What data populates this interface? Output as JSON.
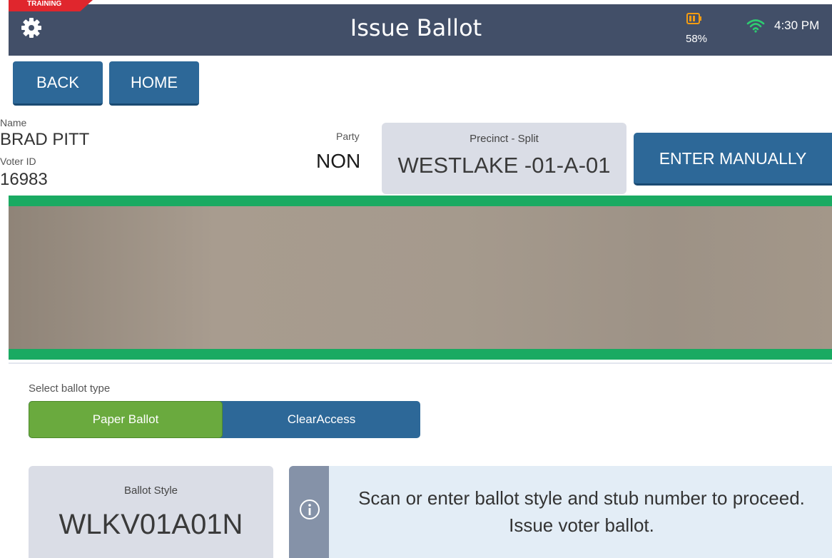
{
  "header": {
    "training_label": "TRAINING",
    "title": "Issue Ballot",
    "battery_percent": "58%",
    "time": "4:30 PM",
    "icons": {
      "settings": "gear-icon",
      "battery": "battery-icon",
      "wifi": "wifi-icon"
    },
    "colors": {
      "bar": "#424f68",
      "training": "#e0262d",
      "battery": "#f39c12",
      "wifi": "#2ecc71"
    }
  },
  "nav": {
    "back_label": "BACK",
    "home_label": "HOME"
  },
  "voter": {
    "name_label": "Name",
    "name": "BRAD PITT",
    "voter_id_label": "Voter ID",
    "voter_id": "16983",
    "party_label": "Party",
    "party": "NON",
    "precinct_label": "Precinct - Split",
    "precinct": "WESTLAKE -01-A-01"
  },
  "enter_manually_label": "ENTER MANUALLY",
  "ballot_type": {
    "label": "Select ballot type",
    "options": [
      "Paper Ballot",
      "ClearAccess"
    ],
    "selected": "Paper Ballot"
  },
  "ballot_style": {
    "label": "Ballot Style",
    "value": "WLKV01A01N"
  },
  "info": {
    "icon": "info-icon",
    "message": "Scan or enter ballot style and stub number to proceed. Issue voter ballot."
  }
}
